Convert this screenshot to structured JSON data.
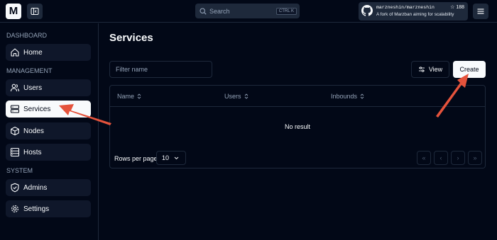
{
  "header": {
    "logo_letter": "M",
    "search_label": "Search",
    "search_shortcut": "CTRL K",
    "repo": {
      "name": "marzneshin/marzneshin",
      "stars": "☆ 188",
      "description": "A fork of Marzban aiming for scalability"
    }
  },
  "sidebar": {
    "sections": [
      {
        "title": "DASHBOARD",
        "items": [
          {
            "label": "Home",
            "icon": "home-icon"
          }
        ]
      },
      {
        "title": "MANAGEMENT",
        "items": [
          {
            "label": "Users",
            "icon": "users-icon"
          },
          {
            "label": "Services",
            "icon": "server-icon",
            "active": true
          },
          {
            "label": "Nodes",
            "icon": "box-icon"
          },
          {
            "label": "Hosts",
            "icon": "grid-icon"
          }
        ]
      },
      {
        "title": "SYSTEM",
        "items": [
          {
            "label": "Admins",
            "icon": "shield-icon"
          },
          {
            "label": "Settings",
            "icon": "gear-icon"
          }
        ]
      }
    ]
  },
  "main": {
    "title": "Services",
    "filter_placeholder": "Filter name",
    "view_label": "View",
    "create_label": "Create",
    "table": {
      "columns": [
        "Name",
        "Users",
        "Inbounds"
      ],
      "empty_message": "No result",
      "rows_per_page_label": "Rows per page",
      "rows_per_page_value": "10",
      "pagination": [
        "«",
        "‹",
        "›",
        "»"
      ]
    }
  },
  "colors": {
    "background": "#020817",
    "surface": "#0f172a",
    "border": "#1e293b",
    "annotation_arrow": "#e5533c"
  }
}
